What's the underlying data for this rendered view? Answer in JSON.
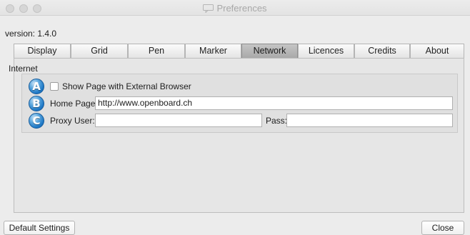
{
  "window": {
    "title": "Preferences"
  },
  "version_label": "version: 1.4.0",
  "tabs": [
    {
      "label": "Display"
    },
    {
      "label": "Grid"
    },
    {
      "label": "Pen"
    },
    {
      "label": "Marker"
    },
    {
      "label": "Network",
      "active": true
    },
    {
      "label": "Licences"
    },
    {
      "label": "Credits"
    },
    {
      "label": "About"
    }
  ],
  "internet": {
    "group_title": "Internet",
    "badges": [
      "A",
      "B",
      "C"
    ],
    "external_browser": {
      "label": "Show Page with External Browser",
      "checked": false
    },
    "home_page": {
      "label": "Home Page:",
      "value": "http://www.openboard.ch"
    },
    "proxy_user": {
      "label": "Proxy User:",
      "value": ""
    },
    "proxy_pass": {
      "label": "Pass:",
      "value": ""
    }
  },
  "footer": {
    "default_settings_label": "Default Settings",
    "close_label": "Close"
  },
  "colors": {
    "active_tab": "#b4b4b4",
    "badge_blue": "#1e78c6"
  }
}
